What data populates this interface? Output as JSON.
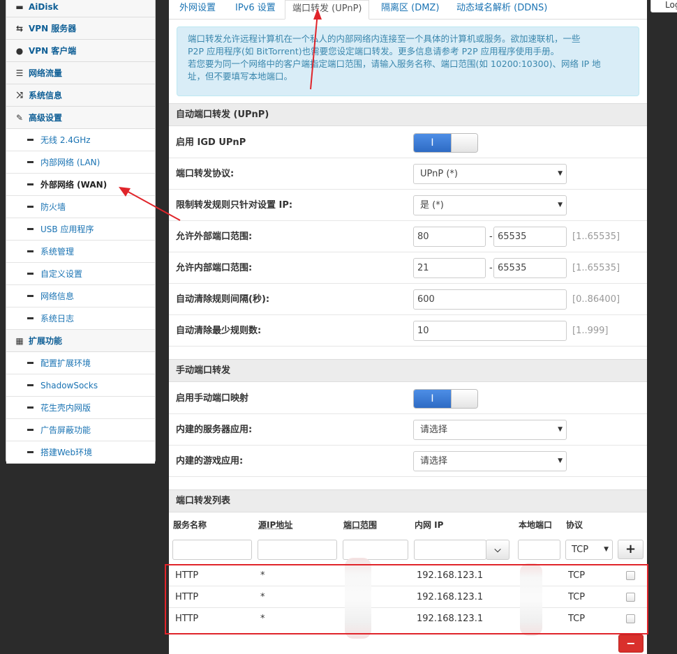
{
  "sidebar": {
    "top_items": [
      {
        "label": "AiDisk",
        "icon": "drive-icon"
      },
      {
        "label": "VPN 服务器",
        "icon": "network-icon"
      },
      {
        "label": "VPN 客户端",
        "icon": "globe-icon"
      },
      {
        "label": "网络流量",
        "icon": "list-icon"
      },
      {
        "label": "系统信息",
        "icon": "shuffle-icon"
      },
      {
        "label": "高级设置",
        "icon": "wrench-icon"
      }
    ],
    "advanced_items": [
      "无线 2.4GHz",
      "内部网络 (LAN)",
      "外部网络 (WAN)",
      "防火墙",
      "USB 应用程序",
      "系统管理",
      "自定义设置",
      "网络信息",
      "系统日志"
    ],
    "ext_header": {
      "label": "扩展功能",
      "icon": "grid-icon"
    },
    "ext_items": [
      "配置扩展环境",
      "ShadowSocks",
      "花生壳内网版",
      "广告屏蔽功能",
      "搭建Web环境"
    ]
  },
  "top_right": {
    "label": "Log"
  },
  "tabs": [
    "外网设置",
    "IPv6 设置",
    "端口转发 (UPnP)",
    "隔离区 (DMZ)",
    "动态域名解析 (DDNS)"
  ],
  "info": [
    "端口转发允许远程计算机在一个私人的内部网络内连接至一个具体的计算机或服务。欲加速联机，一些",
    "P2P 应用程序(如 BitTorrent)也需要您设定端口转发。更多信息请参考 P2P 应用程序使用手册。",
    "若您要为同一个网络中的客户端指定端口范围，请输入服务名称、端口范围(如 10200:10300)、网络 IP 地",
    "址，但不要填写本地端口。"
  ],
  "upnp": {
    "section": "自动端口转发 (UPnP)",
    "enable_label": "启用 IGD UPnP",
    "toggle_on": "I",
    "protocol_label": "端口转发协议:",
    "protocol_value": "UPnP (*)",
    "restrict_label": "限制转发规则只针对设置 IP:",
    "restrict_value": "是 (*)",
    "ext_range_label": "允许外部端口范围:",
    "ext_from": "80",
    "ext_to": "65535",
    "ext_hint": "[1..65535]",
    "int_range_label": "允许内部端口范围:",
    "int_from": "21",
    "int_to": "65535",
    "int_hint": "[1..65535]",
    "clean_interval_label": "自动清除规则间隔(秒):",
    "clean_interval": "600",
    "clean_interval_hint": "[0..86400]",
    "clean_min_label": "自动清除最少规则数:",
    "clean_min": "10",
    "clean_min_hint": "[1..999]"
  },
  "manual": {
    "section": "手动端口转发",
    "enable_label": "启用手动端口映射",
    "toggle_on": "I",
    "server_label": "内建的服务器应用:",
    "server_value": "请选择",
    "game_label": "内建的游戏应用:",
    "game_value": "请选择"
  },
  "list": {
    "section": "端口转发列表",
    "headers": [
      "服务名称",
      "源IP地址",
      "端口范围",
      "内网 IP",
      "本地端口",
      "协议"
    ],
    "proto_default": "TCP",
    "add_label": "+",
    "remove_label": "−",
    "rows": [
      {
        "name": "HTTP",
        "src": "*",
        "ip": "192.168.123.1",
        "proto": "TCP"
      },
      {
        "name": "HTTP",
        "src": "*",
        "ip": "192.168.123.1",
        "proto": "TCP"
      },
      {
        "name": "HTTP",
        "src": "*",
        "ip": "192.168.123.1",
        "proto": "TCP"
      }
    ]
  },
  "colors": {
    "accent": "#1a73b3",
    "annotation": "#e0242a",
    "info_bg": "#d9edf7",
    "toggle_on": "#2e6bc4"
  }
}
